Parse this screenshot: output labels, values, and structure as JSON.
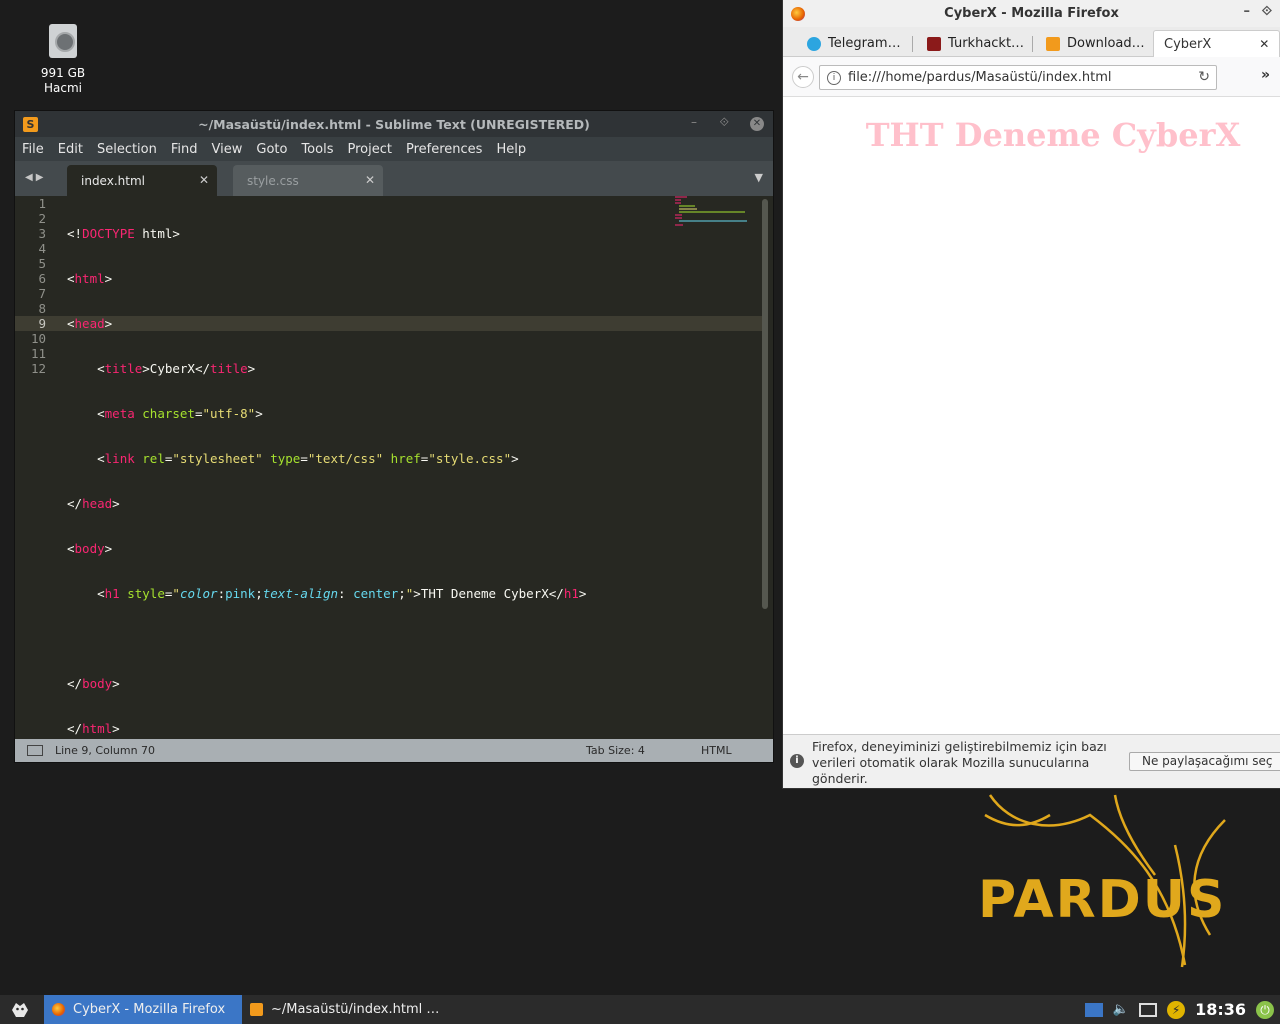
{
  "desktop": {
    "icon_label_1": "991 GB",
    "icon_label_2": "Hacmi"
  },
  "sublime": {
    "title": "~/Masaüstü/index.html - Sublime Text (UNREGISTERED)",
    "menu": [
      "File",
      "Edit",
      "Selection",
      "Find",
      "View",
      "Goto",
      "Tools",
      "Project",
      "Preferences",
      "Help"
    ],
    "tabs": [
      {
        "label": "index.html",
        "active": true
      },
      {
        "label": "style.css",
        "active": false
      }
    ],
    "line_numbers": [
      "1",
      "2",
      "3",
      "4",
      "5",
      "6",
      "7",
      "8",
      "9",
      "10",
      "11",
      "12"
    ],
    "current_line": 9,
    "status": {
      "position": "Line 9, Column 70",
      "tab_size": "Tab Size: 4",
      "syntax": "HTML"
    }
  },
  "firefox": {
    "title": "CyberX - Mozilla Firefox",
    "tabs": [
      {
        "label": "Telegram…",
        "icon": "telegram-icon",
        "color": "#2ca5e0"
      },
      {
        "label": "Turkhackt…",
        "icon": "turkhackteam-icon",
        "color": "#8b1a1a"
      },
      {
        "label": "Download…",
        "icon": "sublime-icon",
        "color": "#f29a1c"
      },
      {
        "label": "CyberX",
        "icon": "",
        "active": true
      }
    ],
    "url": "file:///home/pardus/Masaüstü/index.html",
    "page_heading": "THT Deneme CyberX",
    "notification": {
      "message": "Firefox, deneyiminizi geliştirebilmemiz için bazı verileri otomatik olarak Mozilla sunucularına gönderir.",
      "button": "Ne paylaşacağımı seç"
    }
  },
  "taskbar": {
    "items": [
      {
        "label": "CyberX - Mozilla Firefox",
        "active": true
      },
      {
        "label": "~/Masaüstü/index.html …",
        "active": false
      }
    ],
    "clock": "18:36"
  },
  "wallpaper": {
    "logo_text": "PARDUS",
    "logo_color": "#e0a81c"
  },
  "colors": {
    "accent": "#3b76c6",
    "heading_pink": "#ffc0cb"
  }
}
